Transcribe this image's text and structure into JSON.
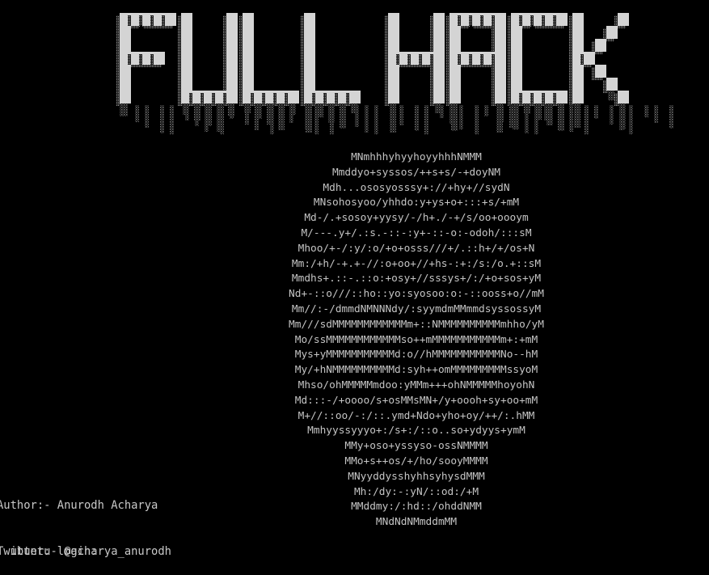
{
  "banner": {
    "text": "FULL HACK",
    "colors": {
      "light": "#d4d4d4",
      "shade": "#7a7a7a",
      "dark": "#3a3a3a"
    }
  },
  "ascii_art": [
    "MNmhhhyhyyhoyyhhhNMMM",
    "Mmddyo+syssos/++s+s/-+doyNM",
    "Mdh...ososyosssy+://+hy+//sydN",
    "MNsohosyoo/yhhdo:y+ys+o+:::+s/+mM",
    "Md-/.+sosoy+yysy/-/h+./-+/s/oo+oooym",
    "M/---.y+/.:s.-::-:y+-::-o:-odoh/:::sM",
    "Mhoo/+-/:y/:o/+o+osss///+/.::h+/+/os+N",
    "Mm:/+h/-+.+-//:o+oo+//+hs-:+:/s:/o.+::sM",
    "Mmdhs+.::-.::o:+osy+//sssys+/:/+o+sos+yM",
    "Nd+-::o///::ho::yo:syosoo:o:-::ooss+o//mM",
    "Mm//:-/dmmdNMNNNdy/:syymdmMMmmdsyssossyM",
    "Mm///sdMMMMMMMMMMMMm+::NMMMMMMMMMMmhho/yM",
    "Mo/ssMMMMMMMMMMMMso++mMMMMMMMMMMMm+:+mM",
    "Mys+yMMMMMMMMMMMd:o//hMMMMMMMMMMMNo--hM",
    "My/+hNMMMMMMMMMMd:syh++omMMMMMMMMMssyoM",
    "Mhso/ohMMMMMmdoo:yMMm+++ohNMMMMMhoyohN",
    "Md:::-/+oooo/s+osMMsMN+/y+oooh+sy+oo+mM",
    "M+//::oo/-:/::.ymd+Ndo+yho+oy/++/:.hMM",
    "Mmhyyssyyyo+:/s+:/::o..so+ydyys+ymM",
    "MMy+oso+yssyso-ossNMMMM",
    "MMo+s++os/+/ho/sooyMMMM",
    "MNyyddysshyhhsyhysdMMM",
    "Mh:/dy:-:yN/::od:/+M",
    "MMddmy:/:hd::/ohddNMM",
    "MNdNdNMmddmMM"
  ],
  "credits": {
    "author": "Author:- Anurodh Acharya",
    "twitter": "Twitter:- @acharya_anurodh"
  },
  "login": {
    "prompt": "ubuntu login:"
  }
}
